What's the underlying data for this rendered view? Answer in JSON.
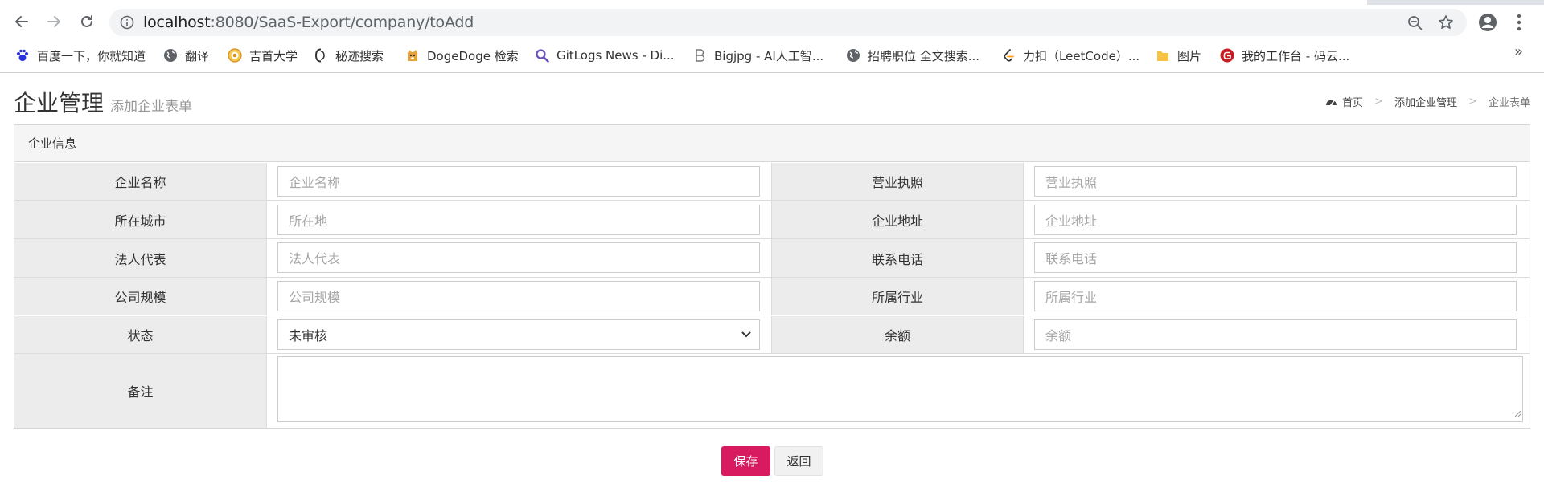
{
  "browser": {
    "url_host": "localhost",
    "url_path": ":8080/SaaS-Export/company/toAdd",
    "bookmarks": [
      {
        "label": "百度一下，你就知道",
        "icon": "baidu-paw-icon"
      },
      {
        "label": "翻译",
        "icon": "globe-icon"
      },
      {
        "label": "吉首大学",
        "icon": "university-logo-icon"
      },
      {
        "label": "秘迹搜索",
        "icon": "mijisou-icon"
      },
      {
        "label": "DogeDoge 检索",
        "icon": "doge-icon"
      },
      {
        "label": "GitLogs News - Di...",
        "icon": "magnifier-icon"
      },
      {
        "label": "Bigjpg - AI人工智...",
        "icon": "bigjpg-b-icon"
      },
      {
        "label": "招聘职位 全文搜索...",
        "icon": "globe-icon"
      },
      {
        "label": "力扣（LeetCode）...",
        "icon": "leetcode-icon"
      },
      {
        "label": "图片",
        "icon": "folder-icon"
      },
      {
        "label": "我的工作台 - 码云...",
        "icon": "gitee-icon"
      }
    ],
    "more_label": "»"
  },
  "page": {
    "title": "企业管理",
    "subtitle": "添加企业表单",
    "breadcrumb": [
      "首页",
      "添加企业管理",
      "企业表单"
    ],
    "breadcrumb_sep": ">"
  },
  "form": {
    "header": "企业信息",
    "rows": [
      {
        "label_left": "企业名称",
        "ph_left": "企业名称",
        "label_right": "营业执照",
        "ph_right": "营业执照"
      },
      {
        "label_left": "所在城市",
        "ph_left": "所在地",
        "label_right": "企业地址",
        "ph_right": "企业地址"
      },
      {
        "label_left": "法人代表",
        "ph_left": "法人代表",
        "label_right": "联系电话",
        "ph_right": "联系电话"
      },
      {
        "label_left": "公司规模",
        "ph_left": "公司规模",
        "label_right": "所属行业",
        "ph_right": "所属行业"
      },
      {
        "label_left": "状态",
        "select_value": "未审核",
        "label_right": "余额",
        "ph_right": "余额"
      }
    ],
    "remark_label": "备注",
    "save_label": "保存",
    "back_label": "返回"
  },
  "colors": {
    "primary_button": "#d81b60",
    "label_bg": "#ececec",
    "header_bg": "#f5f5f5"
  }
}
